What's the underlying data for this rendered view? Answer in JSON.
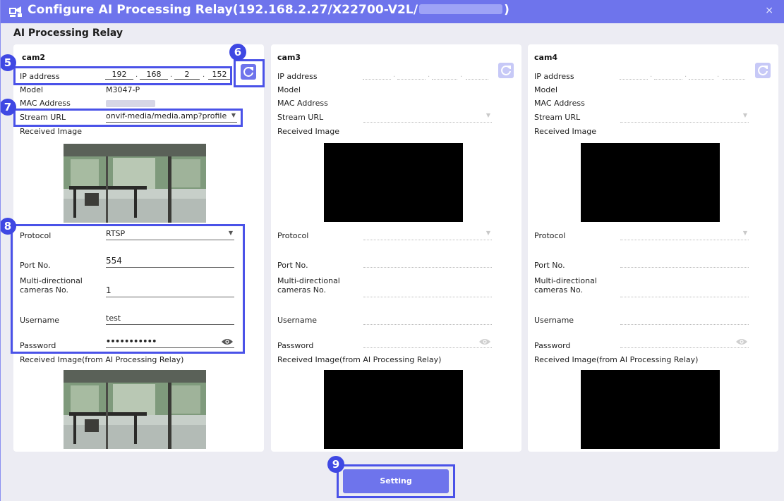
{
  "window": {
    "title_prefix": "Configure AI Processing Relay(192.168.2.27/X22700-V2L/",
    "title_suffix": ")",
    "close_label": "×",
    "subtitle": "AI Processing Relay"
  },
  "labels": {
    "ip_address": "IP address",
    "model": "Model",
    "mac_address": "MAC Address",
    "stream_url": "Stream URL",
    "received_image": "Received Image",
    "protocol": "Protocol",
    "port_no": "Port No.",
    "multi_line1": "Multi-directional",
    "multi_line2": "cameras No.",
    "username": "Username",
    "password": "Password",
    "received_image_relay": "Received Image(from AI Processing Relay)"
  },
  "cams": [
    {
      "name": "cam2",
      "ip": [
        "192",
        "168",
        "2",
        "152"
      ],
      "model": "M3047-P",
      "stream_url": "onvif-media/media.amp?profile",
      "protocol": "RTSP",
      "port": "554",
      "multi_cameras": "1",
      "username": "test",
      "password": "•••••••••••"
    },
    {
      "name": "cam3"
    },
    {
      "name": "cam4"
    }
  ],
  "annotations": {
    "b5": "5",
    "b6": "6",
    "b7": "7",
    "b8": "8",
    "b9": "9"
  },
  "setting_button": "Setting",
  "colors": {
    "accent": "#6e74ec",
    "highlight": "#4a52e8",
    "badge": "#3f48e3",
    "background": "#ececf3"
  }
}
